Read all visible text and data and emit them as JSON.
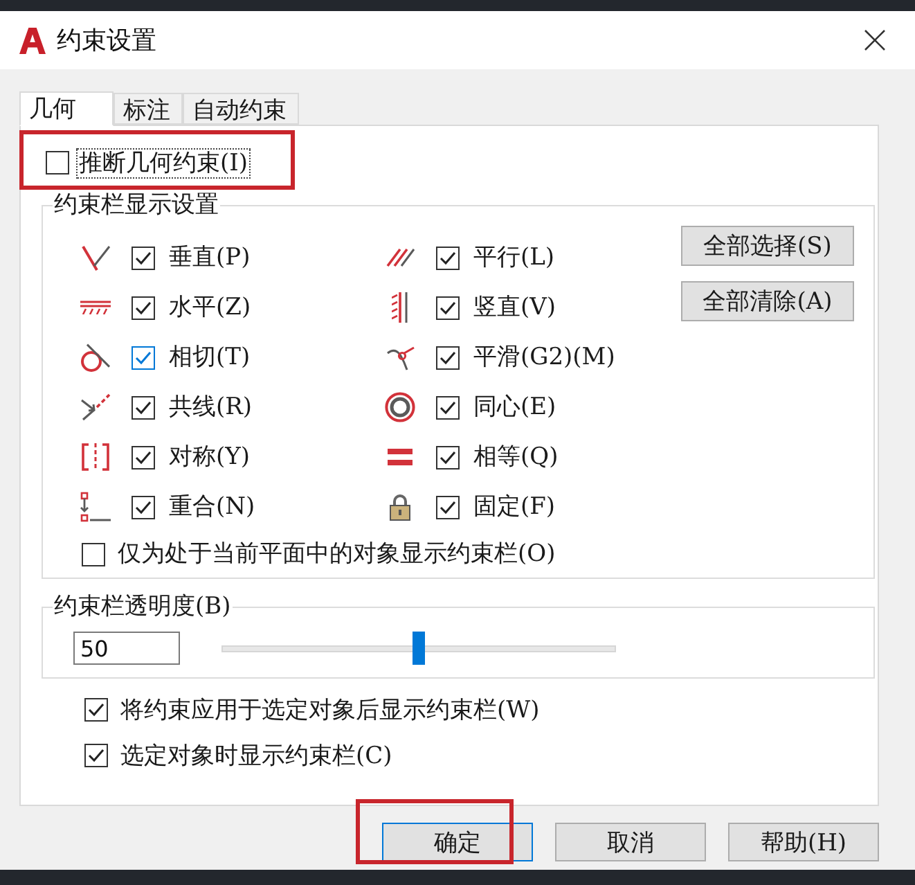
{
  "window": {
    "title": "约束设置"
  },
  "tabs": [
    {
      "label": "几何",
      "selected": true
    },
    {
      "label": "标注",
      "selected": false
    },
    {
      "label": "自动约束",
      "selected": false
    }
  ],
  "infer_constraints": {
    "label": "推断几何约束(I)",
    "checked": false,
    "focused": true,
    "highlighted": true
  },
  "constraint_bar_settings": {
    "title": "约束栏显示设置",
    "constraints": [
      {
        "kind": "perpendicular",
        "label": "垂直(P)",
        "checked": true,
        "hovered": false
      },
      {
        "kind": "parallel",
        "label": "平行(L)",
        "checked": true,
        "hovered": false
      },
      {
        "kind": "horizontal",
        "label": "水平(Z)",
        "checked": true,
        "hovered": false
      },
      {
        "kind": "vertical",
        "label": "竖直(V)",
        "checked": true,
        "hovered": false
      },
      {
        "kind": "tangent",
        "label": "相切(T)",
        "checked": true,
        "hovered": true
      },
      {
        "kind": "smooth",
        "label": "平滑(G2)(M)",
        "checked": true,
        "hovered": false
      },
      {
        "kind": "collinear",
        "label": "共线(R)",
        "checked": true,
        "hovered": false
      },
      {
        "kind": "concentric",
        "label": "同心(E)",
        "checked": true,
        "hovered": false
      },
      {
        "kind": "symmetric",
        "label": "对称(Y)",
        "checked": true,
        "hovered": false
      },
      {
        "kind": "equal",
        "label": "相等(Q)",
        "checked": true,
        "hovered": false
      },
      {
        "kind": "coincident",
        "label": "重合(N)",
        "checked": true,
        "hovered": false
      },
      {
        "kind": "fix",
        "label": "固定(F)",
        "checked": true,
        "hovered": false
      }
    ],
    "select_all_button": "全部选择(S)",
    "clear_all_button": "全部清除(A)",
    "current_plane_only": {
      "label": "仅为处于当前平面中的对象显示约束栏(O)",
      "checked": false
    }
  },
  "transparency": {
    "title": "约束栏透明度(B)",
    "value": "50",
    "level": 0.5
  },
  "options": [
    {
      "label": "将约束应用于选定对象后显示约束栏(W)",
      "checked": true
    },
    {
      "label": "选定对象时显示约束栏(C)",
      "checked": true
    }
  ],
  "buttons": [
    {
      "label": "确定",
      "default": true,
      "highlighted": true
    },
    {
      "label": "取消",
      "default": false,
      "highlighted": false
    },
    {
      "label": "帮助(H)",
      "default": false,
      "highlighted": false
    }
  ]
}
